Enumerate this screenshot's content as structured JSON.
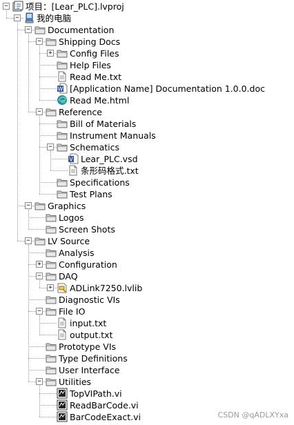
{
  "watermark": "CSDN @qADLXYxa",
  "tree": [
    {
      "label": "项目：[Lear_PLC].lvproj",
      "icon": "project-icon",
      "depth": 0,
      "expander": "minus"
    },
    {
      "label": "我的电脑",
      "icon": "computer-icon",
      "depth": 1,
      "expander": "minus"
    },
    {
      "label": "Documentation",
      "icon": "folder-icon",
      "depth": 2,
      "expander": "minus"
    },
    {
      "label": "Shipping Docs",
      "icon": "folder-icon",
      "depth": 3,
      "expander": "minus"
    },
    {
      "label": "Config Files",
      "icon": "folder-icon",
      "depth": 4,
      "expander": "plus"
    },
    {
      "label": "Help Files",
      "icon": "folder-icon",
      "depth": 4,
      "expander": "none"
    },
    {
      "label": "Read Me.txt",
      "icon": "text-file-icon",
      "depth": 4,
      "expander": "none"
    },
    {
      "label": "[Application Name] Documentation 1.0.0.doc",
      "icon": "word-doc-icon",
      "depth": 4,
      "expander": "none"
    },
    {
      "label": "Read Me.html",
      "icon": "edge-browser-icon",
      "depth": 4,
      "expander": "none"
    },
    {
      "label": "Reference",
      "icon": "folder-icon",
      "depth": 3,
      "expander": "minus"
    },
    {
      "label": "Bill of Materials",
      "icon": "folder-icon",
      "depth": 4,
      "expander": "none"
    },
    {
      "label": "Instrument Manuals",
      "icon": "folder-icon",
      "depth": 4,
      "expander": "none"
    },
    {
      "label": "Schematics",
      "icon": "folder-icon",
      "depth": 4,
      "expander": "minus"
    },
    {
      "label": "Lear_PLC.vsd",
      "icon": "visio-file-icon",
      "depth": 5,
      "expander": "none"
    },
    {
      "label": "条形码格式.txt",
      "icon": "text-file-icon",
      "depth": 5,
      "expander": "none"
    },
    {
      "label": "Specifications",
      "icon": "folder-icon",
      "depth": 4,
      "expander": "none"
    },
    {
      "label": "Test Plans",
      "icon": "folder-icon",
      "depth": 4,
      "expander": "none"
    },
    {
      "label": "Graphics",
      "icon": "folder-icon",
      "depth": 2,
      "expander": "minus"
    },
    {
      "label": "Logos",
      "icon": "folder-icon",
      "depth": 3,
      "expander": "none"
    },
    {
      "label": "Screen Shots",
      "icon": "folder-icon",
      "depth": 3,
      "expander": "none"
    },
    {
      "label": "LV Source",
      "icon": "folder-icon",
      "depth": 2,
      "expander": "minus"
    },
    {
      "label": "Analysis",
      "icon": "folder-icon",
      "depth": 3,
      "expander": "none"
    },
    {
      "label": "Configuration",
      "icon": "folder-icon",
      "depth": 3,
      "expander": "plus"
    },
    {
      "label": "DAQ",
      "icon": "folder-icon",
      "depth": 3,
      "expander": "minus"
    },
    {
      "label": "ADLink7250.lvlib",
      "icon": "lvlib-icon",
      "depth": 4,
      "expander": "plus"
    },
    {
      "label": "Diagnostic VIs",
      "icon": "folder-icon",
      "depth": 3,
      "expander": "none"
    },
    {
      "label": "File IO",
      "icon": "folder-icon",
      "depth": 3,
      "expander": "minus"
    },
    {
      "label": "input.txt",
      "icon": "text-file-icon",
      "depth": 4,
      "expander": "none"
    },
    {
      "label": "output.txt",
      "icon": "text-file-icon",
      "depth": 4,
      "expander": "none"
    },
    {
      "label": "Prototype VIs",
      "icon": "folder-icon",
      "depth": 3,
      "expander": "none"
    },
    {
      "label": "Type Definitions",
      "icon": "folder-icon",
      "depth": 3,
      "expander": "none"
    },
    {
      "label": "User Interface",
      "icon": "folder-icon",
      "depth": 3,
      "expander": "none"
    },
    {
      "label": "Utilities",
      "icon": "folder-icon",
      "depth": 3,
      "expander": "minus"
    },
    {
      "label": "TopVIPath.vi",
      "icon": "vi-icon",
      "depth": 4,
      "expander": "none"
    },
    {
      "label": "ReadBarCode.vi",
      "icon": "vi-icon",
      "depth": 4,
      "expander": "none"
    },
    {
      "label": "BarCodeExact.vi",
      "icon": "vi-icon",
      "depth": 4,
      "expander": "none"
    }
  ]
}
